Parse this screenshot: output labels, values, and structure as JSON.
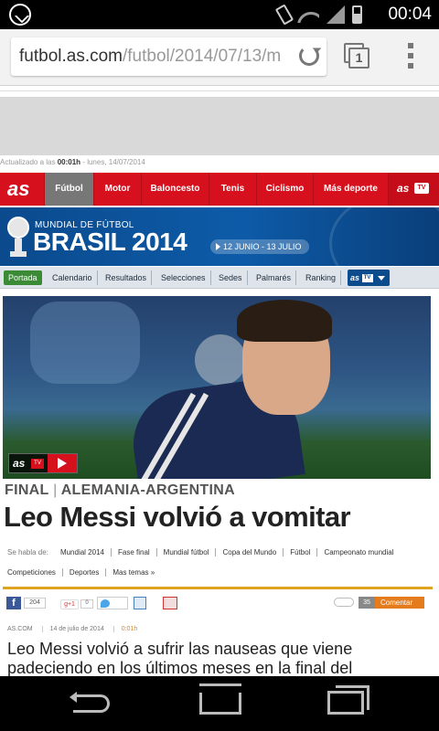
{
  "status_bar": {
    "time": "00:04"
  },
  "browser": {
    "url_host": "futbol.as.com",
    "url_path": "/futbol/2014/07/13/m",
    "tab_count": "1"
  },
  "page": {
    "updated_prefix": "Actualizado a las",
    "updated_time": "00:01h",
    "updated_suffix": "- lunes, 14/07/2014",
    "logo": "as",
    "main_nav": {
      "items": [
        "Fútbol",
        "Motor",
        "Baloncesto",
        "Tenis",
        "Ciclismo",
        "Más deporte"
      ],
      "tv_logo": "as",
      "tv_tag": "TV"
    },
    "brasil": {
      "kicker": "MUNDIAL DE FÚTBOL",
      "title": "BRASIL 2014",
      "dates": "12 JUNIO - 13 JULIO"
    },
    "sub_nav": {
      "items": [
        "Portada",
        "Calendario",
        "Resultados",
        "Selecciones",
        "Sedes",
        "Palmarés",
        "Ranking"
      ],
      "tv_logo": "as",
      "tv_tag": "TV"
    },
    "hero": {
      "badge_logo": "as",
      "badge_tv": "TV"
    },
    "kicker": {
      "left": "FINAL",
      "sep": "|",
      "right": "ALEMANIA-ARGENTINA"
    },
    "headline": "Leo Messi volvió a vomitar",
    "tags_label": "Se habla de:",
    "tags_row1": [
      "Mundial 2014",
      "Fase final",
      "Mundial fútbol",
      "Copa del Mundo",
      "Fútbol",
      "Campeonato mundial"
    ],
    "tags_row2": [
      "Competiciones",
      "Deportes",
      "Mas temas »"
    ],
    "share": {
      "fb_icon": "f",
      "fb_count": "204",
      "gplus": "g+1",
      "gplus_count": "0",
      "comment_count": "35",
      "comment_label": "Comentar"
    },
    "meta": {
      "source": "AS.COM",
      "date": "14 de julio de 2014",
      "time": "0:01h"
    },
    "lead": "Leo Messi volvió a sufrir las nauseas que viene padeciendo en los últimos meses en la final del"
  },
  "colors": {
    "brand_red": "#d6101d",
    "brasil_blue": "#0d5ba8",
    "share_orange": "#e47b1d"
  }
}
